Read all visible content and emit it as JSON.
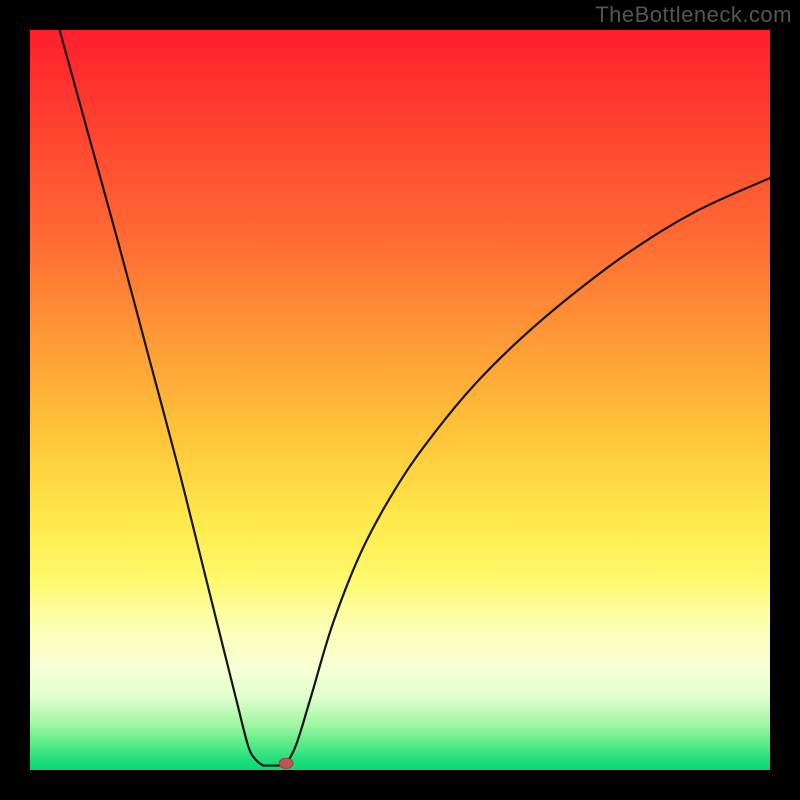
{
  "watermark": "TheBottleneck.com",
  "chart_data": {
    "type": "line",
    "title": "",
    "xlabel": "",
    "ylabel": "",
    "xlim": [
      0,
      100
    ],
    "ylim": [
      0,
      100
    ],
    "grid": false,
    "legend": false,
    "background_gradient": [
      "#ff1e2d",
      "#ff9a36",
      "#fff96a",
      "#17dd7a"
    ],
    "series": [
      {
        "name": "left-branch",
        "x": [
          4,
          8,
          12,
          16,
          20,
          24,
          26,
          28,
          29.5,
          30.5,
          31.5
        ],
        "y": [
          100,
          85.5,
          71,
          56,
          41,
          25,
          17,
          9,
          3.2,
          1.4,
          0.6
        ]
      },
      {
        "name": "right-branch",
        "x": [
          34.5,
          36,
          38,
          41,
          45,
          50,
          55,
          60,
          66,
          73,
          81,
          90,
          100
        ],
        "y": [
          0.6,
          3.5,
          10,
          20,
          30,
          39,
          46,
          52,
          58,
          64,
          70,
          75.5,
          80
        ]
      },
      {
        "name": "floor-segment",
        "x": [
          31.5,
          34.5
        ],
        "y": [
          0.6,
          0.6
        ]
      }
    ],
    "marker": {
      "x": 34.6,
      "y": 0.9,
      "color": "#c0554f"
    },
    "annotations": []
  }
}
